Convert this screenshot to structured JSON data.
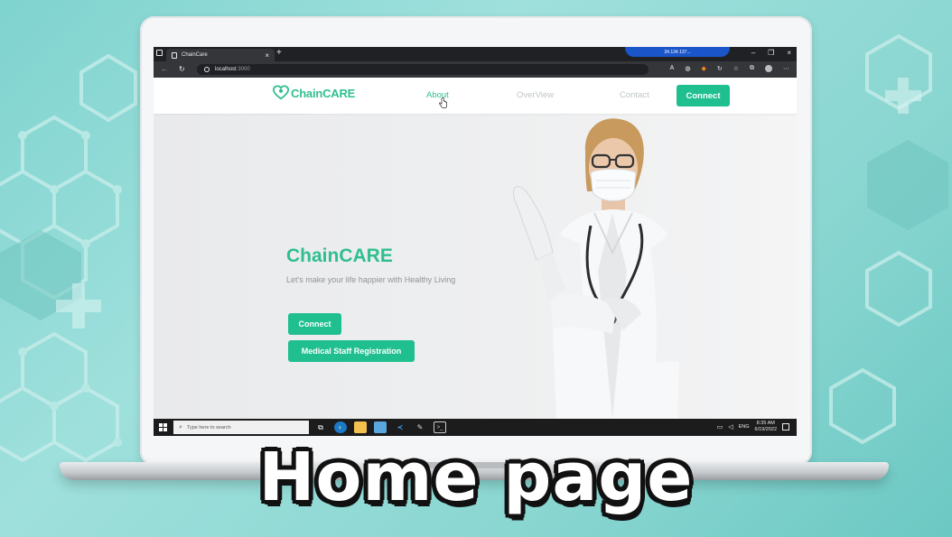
{
  "browser": {
    "tab_title": "ChainCare",
    "tab_close": "×",
    "new_tab": "+",
    "url_host": "localhost",
    "url_port": ":3000",
    "remote_session": "34.134.137...",
    "window_controls": [
      "–",
      "❐",
      "×"
    ]
  },
  "site": {
    "logo_text": "ChainCARE",
    "nav": {
      "about": "About",
      "overview": "OverView",
      "contact": "Contact",
      "connect": "Connect"
    },
    "hero": {
      "title": "ChainCARE",
      "subtitle": "Let's make your life happier with Healthy Living",
      "connect_button": "Connect",
      "register_button": "Medical Staff Registration"
    }
  },
  "taskbar": {
    "search_placeholder": "Type here to search",
    "language": "ENG",
    "time": "8:35 AM",
    "date": "6/19/2022"
  },
  "caption": "Home page",
  "colors": {
    "brand": "#1fbf8f",
    "background": "#8ad6d1"
  }
}
